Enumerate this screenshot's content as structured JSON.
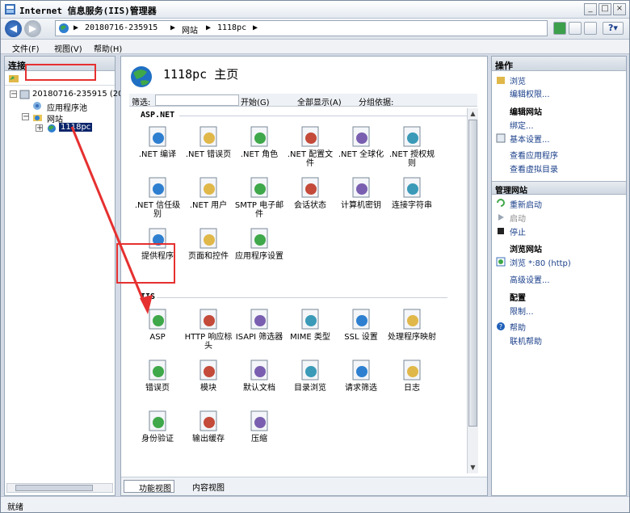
{
  "window": {
    "title": "Internet 信息服务(IIS)管理器"
  },
  "address": {
    "segments": [
      "20180716-235915",
      "网站",
      "1118pc"
    ],
    "sep": "▶"
  },
  "menu": [
    "文件(F)",
    "视图(V)",
    "帮助(H)"
  ],
  "left": {
    "header": "连接",
    "tree": {
      "server": "20180716-235915 (201",
      "pool": "应用程序池",
      "sites": "网站",
      "site": "1118pc"
    }
  },
  "center": {
    "title": "1118pc 主页",
    "filter": {
      "label": "筛选:",
      "start": "开始(G)",
      "showall": "全部显示(A)",
      "group": "分组依据:"
    },
    "sections": {
      "aspnet": "ASP.NET",
      "iis": "IIS"
    },
    "aspnet": [
      ".NET 编译",
      ".NET 错误页",
      ".NET 角色",
      ".NET 配置文件",
      ".NET 全球化",
      ".NET 授权规则",
      ".NET 信任级别",
      ".NET 用户",
      "SMTP 电子邮件",
      "会话状态",
      "计算机密钥",
      "连接字符串",
      "提供程序",
      "页面和控件",
      "应用程序设置"
    ],
    "iis": [
      "ASP",
      "HTTP 响应标头",
      "ISAPI 筛选器",
      "MIME 类型",
      "SSL 设置",
      "处理程序映射",
      "错误页",
      "模块",
      "默认文档",
      "目录浏览",
      "请求筛选",
      "日志",
      "身份验证",
      "输出缓存",
      "压缩"
    ],
    "tabs": {
      "features": "功能视图",
      "content": "内容视图"
    }
  },
  "right": {
    "header": "操作",
    "browse": "浏览",
    "edit_perm": "编辑权限...",
    "edit_site_title": "编辑网站",
    "bind": "绑定...",
    "basic": "基本设置...",
    "view_apps": "查看应用程序",
    "view_vdirs": "查看虚拟目录",
    "manage_title": "管理网站",
    "restart": "重新启动",
    "start": "启动",
    "stop": "停止",
    "browse_site_title": "浏览网站",
    "browse_80": "浏览 *:80 (http)",
    "advanced": "高级设置...",
    "config_title": "配置",
    "limits": "限制...",
    "help": "帮助",
    "online_help": "联机帮助"
  },
  "status": "就绪",
  "colors": {
    "accent": "#1a3f8a",
    "highlight": "#e63030",
    "selected": "#0a246a"
  }
}
